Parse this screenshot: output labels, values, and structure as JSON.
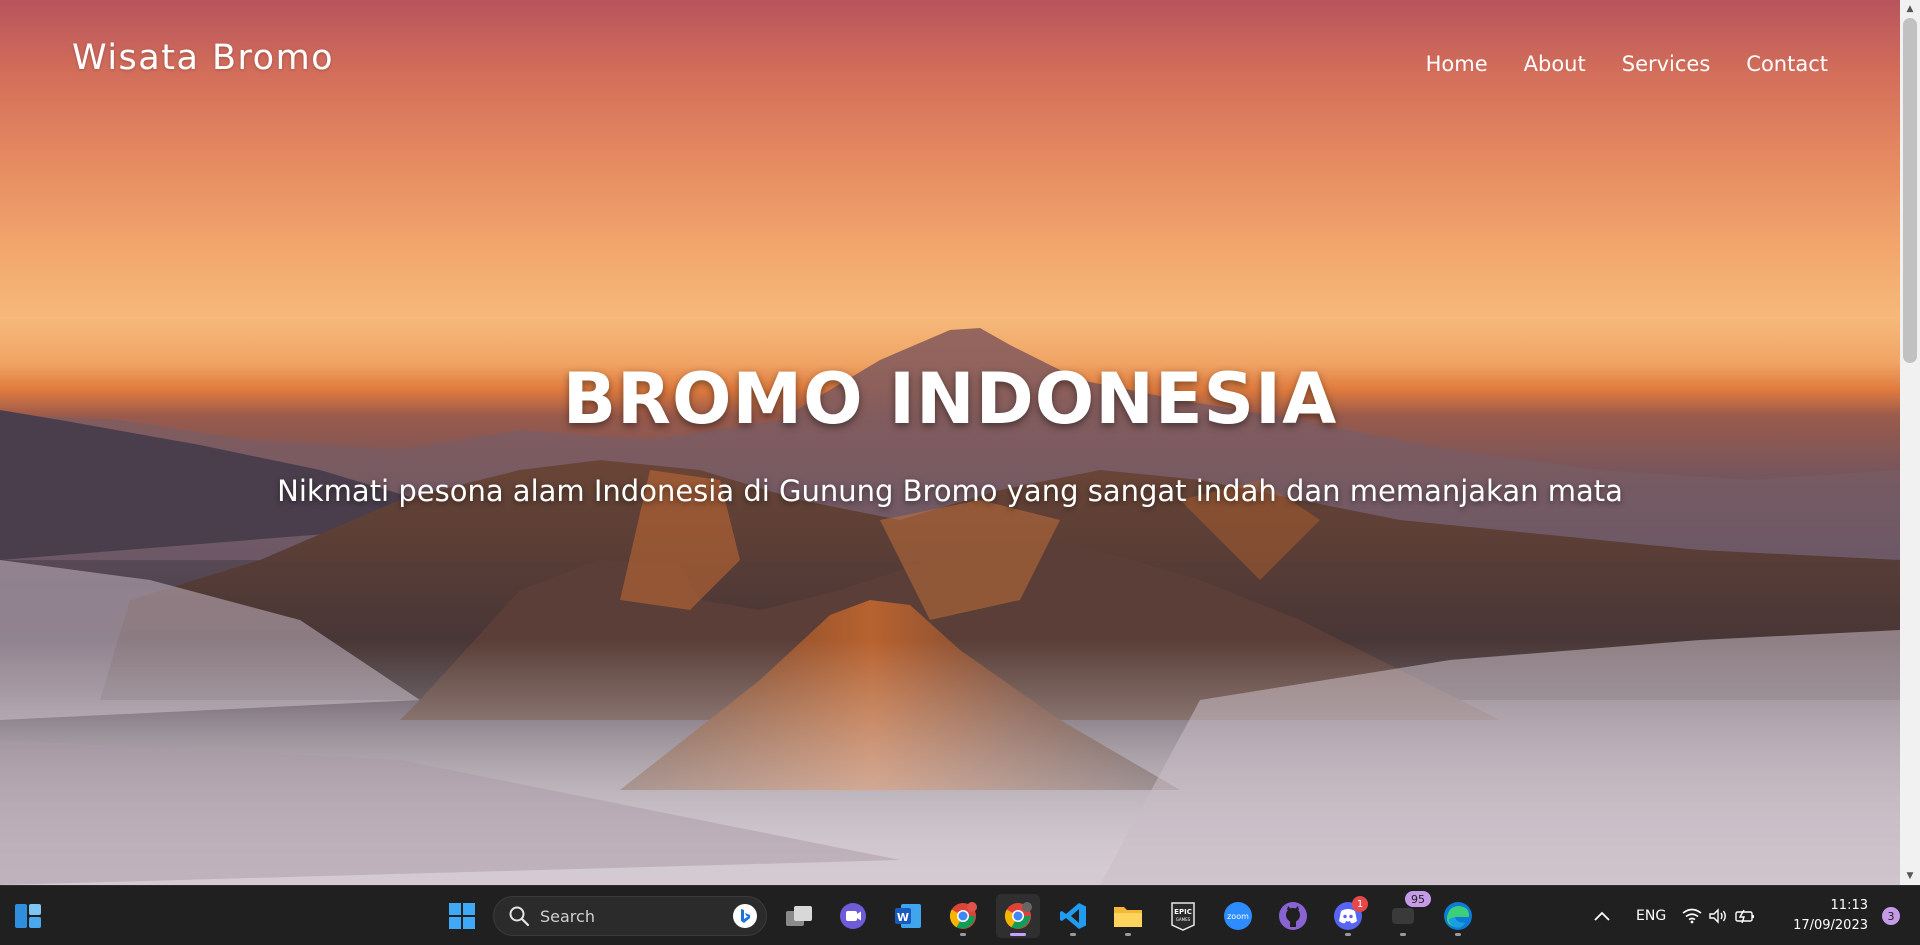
{
  "site": {
    "brand": "Wisata Bromo",
    "nav": [
      "Home",
      "About",
      "Services",
      "Contact"
    ],
    "hero_title": "BROMO INDONESIA",
    "hero_subtitle": "Nikmati pesona alam Indonesia di Gunung Bromo yang sangat indah dan memanjakan mata"
  },
  "taskbar": {
    "search_placeholder": "Search",
    "language": "ENG",
    "time": "11:13",
    "date": "17/09/2023",
    "notification_count": "3",
    "discord_badge": "1",
    "app_badge": "95",
    "apps": [
      "widgets-icon",
      "start-icon",
      "task-view-icon",
      "meet-icon",
      "word-icon",
      "chrome-icon",
      "chrome-icon",
      "vscode-icon",
      "file-explorer-icon",
      "epic-games-icon",
      "zoom-icon",
      "github-icon",
      "discord-icon",
      "app-icon",
      "edge-icon"
    ]
  },
  "colors": {
    "taskbar_bg": "#202020",
    "sky_top": "#b7545c",
    "sky_glow": "#f6b97a",
    "horizon": "#e07b3e"
  }
}
